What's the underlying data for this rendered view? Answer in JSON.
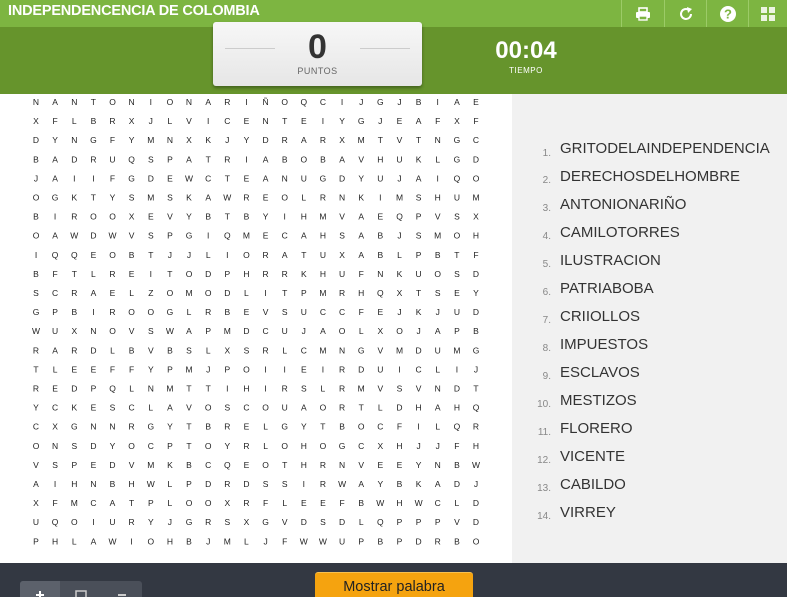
{
  "header": {
    "title": "INDEPENDENCENCIA DE COLOMBIA",
    "buttons": [
      {
        "name": "print-icon"
      },
      {
        "name": "restart-icon"
      },
      {
        "name": "help-icon"
      },
      {
        "name": "menu-grid-icon"
      }
    ]
  },
  "score": {
    "value": "0",
    "label": "PUNTOS"
  },
  "timer": {
    "value": "00:04",
    "label": "TIEMPO"
  },
  "grid": {
    "rows": [
      "NANTONIONARIÑOQCIJGJBIAE",
      "XFLBRXJLVICENTEIYGJEAFXF",
      "DYNGFYMNXKJYDRARXMTVTNGC",
      "BADRUQSPATRIABOBAVHUKLGD",
      "JAIIFGDEWCTEANUGDYUJAIQO",
      "OGKTYSMSKAWREOLRNKIMSHUM",
      "BIROOXEVYBTBYIHMVAEQPVSX",
      "OAWDWVSPGIQMECAHSABJSMOH",
      "IQQEOBTJJLIORATUXABLPBTF",
      "BFTLREITODPHRRKHUFNKUOSD",
      "SCRAELZOMODLITPMRHQXTSEY",
      "GPBIROOGLRBEVSUCCFEJKJUD",
      "WUXNOVSWAPMDCUJAOLXOJAPB",
      "RARDLBVBSLXSRLCMNGVMDUMG",
      "TLEEFFYPMJPOIIEIRDUICLIJ",
      "REDPQLNMTTIHIRSLRMVSVNDT",
      "YCKESCLAVOSCOUAORTLDHAHQ",
      "CXGNNRGYTBRELGYTBOCFILQR",
      "ONSDYOCPTOYRLOHOGCXHJJFH",
      "VSPEDVMKBCQEOTHRNVEEYNBW",
      "AIHNBHWLPDRDSSIRWAYBKADJ",
      "XFMCATPLOOXRFLEEFBWHWCLD",
      "UQOIURYJGRSXGVDSDLQPPPVD",
      "PHLAWIOHBJMLJFWWUPBPDRBO"
    ]
  },
  "words": [
    {
      "n": "1.",
      "text": "GRITODELAINDEPENDENCIA"
    },
    {
      "n": "2.",
      "text": "DERECHOSDELHOMBRE"
    },
    {
      "n": "3.",
      "text": "ANTONIONARIÑO"
    },
    {
      "n": "4.",
      "text": "CAMILOTORRES"
    },
    {
      "n": "5.",
      "text": "ILUSTRACION"
    },
    {
      "n": "6.",
      "text": "PATRIABOBA"
    },
    {
      "n": "7.",
      "text": "CRIIOLLOS"
    },
    {
      "n": "8.",
      "text": "IMPUESTOS"
    },
    {
      "n": "9.",
      "text": "ESCLAVOS"
    },
    {
      "n": "10.",
      "text": "MESTIZOS"
    },
    {
      "n": "11.",
      "text": "FLORERO"
    },
    {
      "n": "12.",
      "text": "VICENTE"
    },
    {
      "n": "13.",
      "text": "CABILDO"
    },
    {
      "n": "14.",
      "text": "VIRREY"
    }
  ],
  "toolbar": {
    "tools": [
      {
        "name": "zoom-in-icon"
      },
      {
        "name": "fit-screen-icon"
      },
      {
        "name": "zoom-out-icon"
      }
    ],
    "show_word_label": "Mostrar palabra"
  },
  "colors": {
    "topbar": "#7db541",
    "scorebar": "#66942c",
    "wordpanel": "#f1f1f1",
    "bottombar": "#333842",
    "button": "#f5a30f"
  }
}
